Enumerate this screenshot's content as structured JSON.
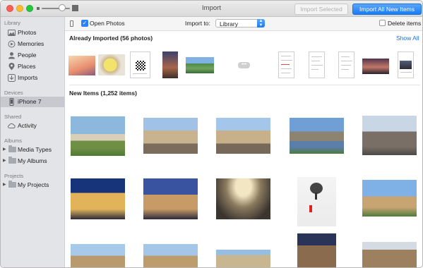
{
  "window": {
    "title": "Import",
    "import_selected_label": "Import Selected",
    "import_all_label": "Import All New Items"
  },
  "sidebar": {
    "library_header": "Library",
    "library_items": [
      {
        "label": "Photos",
        "icon": "photos-icon"
      },
      {
        "label": "Memories",
        "icon": "memories-icon"
      },
      {
        "label": "People",
        "icon": "people-icon"
      },
      {
        "label": "Places",
        "icon": "places-icon"
      },
      {
        "label": "Imports",
        "icon": "imports-icon"
      }
    ],
    "devices_header": "Devices",
    "device_item": {
      "label": "iPhone 7",
      "icon": "iphone-icon",
      "selected": true
    },
    "shared_header": "Shared",
    "shared_item": {
      "label": "Activity",
      "icon": "cloud-icon"
    },
    "albums_header": "Albums",
    "album_items": [
      {
        "label": "Media Types",
        "icon": "folder-icon"
      },
      {
        "label": "My Albums",
        "icon": "folder-icon"
      }
    ],
    "projects_header": "Projects",
    "project_items": [
      {
        "label": "My Projects",
        "icon": "folder-icon"
      }
    ]
  },
  "toolbar": {
    "open_photos_label": "Open Photos",
    "open_photos_checked": true,
    "import_to_label": "Import to:",
    "import_to_value": "Library",
    "delete_items_label": "Delete items",
    "delete_items_checked": false
  },
  "already_imported": {
    "title": "Already Imported (56 photos)",
    "show_all_label": "Show All",
    "more_label": "•••"
  },
  "new_items": {
    "title": "New Items (1,252 items)"
  },
  "colors": {
    "accent": "#1a7cf4",
    "sidebar_bg": "#e3e4e7",
    "sidebar_selected": "#c7c9ce"
  }
}
